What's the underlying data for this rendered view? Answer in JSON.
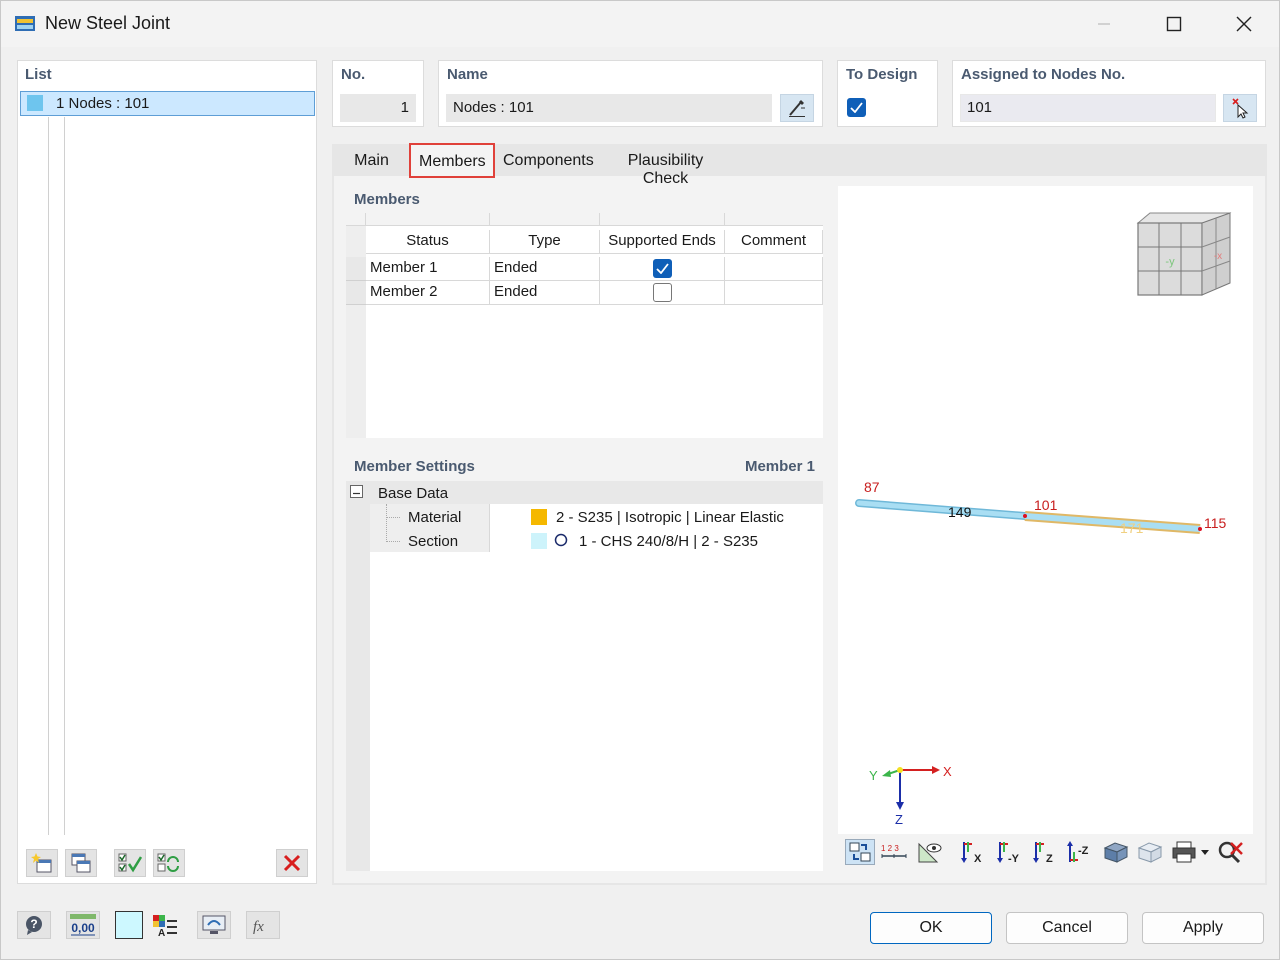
{
  "window": {
    "title": "New Steel Joint"
  },
  "list": {
    "heading": "List",
    "items": [
      {
        "number": "1",
        "label": "Nodes : 101",
        "color": "#6ec5ee"
      }
    ]
  },
  "header": {
    "no_label": "No.",
    "no_value": "1",
    "name_label": "Name",
    "name_value": "Nodes : 101",
    "to_design_label": "To Design",
    "to_design_checked": true,
    "assigned_label": "Assigned to Nodes No.",
    "assigned_value": "101"
  },
  "tabs": [
    {
      "label": "Main",
      "active": false
    },
    {
      "label": "Members",
      "active": true
    },
    {
      "label": "Components",
      "active": false
    },
    {
      "label": "Plausibility Check",
      "active": false
    }
  ],
  "members": {
    "heading": "Members",
    "columns": [
      "Status",
      "Type",
      "Supported Ends",
      "Comment"
    ],
    "rows": [
      {
        "status": "Member 1",
        "type": "Ended",
        "supported_ends": true,
        "comment": ""
      },
      {
        "status": "Member 2",
        "type": "Ended",
        "supported_ends": false,
        "comment": ""
      }
    ]
  },
  "member_settings": {
    "heading": "Member Settings",
    "member_label": "Member 1",
    "group_label": "Base Data",
    "material_label": "Material",
    "material_value": "2 - S235 | Isotropic | Linear Elastic",
    "material_color": "#f5b800",
    "section_label": "Section",
    "section_value": "1 - CHS 240/8/H | 2 - S235",
    "section_color": "#cdf3fb"
  },
  "view3d": {
    "node_labels": [
      "87",
      "149",
      "101",
      "171",
      "115"
    ],
    "cube_face_front": "-y",
    "cube_face_side": "-x",
    "axis_x": "X",
    "axis_y": "Y",
    "axis_z": "Z",
    "toolbar_icons": [
      "view-settings-icon",
      "numbering-icon",
      "visibility-icon",
      "view-x-icon",
      "view-neg-y-icon",
      "view-z-icon",
      "view-neg-z-icon",
      "iso-solid-icon",
      "iso-wire-icon",
      "print-icon",
      "reset-view-icon"
    ]
  },
  "footer": {
    "ok_label": "OK",
    "cancel_label": "Cancel",
    "apply_label": "Apply",
    "icons": [
      "help-icon",
      "decimal-places-icon",
      "color-icon",
      "legend-icon",
      "display-icon",
      "formula-icon"
    ],
    "decimal_text": "0,00",
    "formula_text": "fx"
  }
}
